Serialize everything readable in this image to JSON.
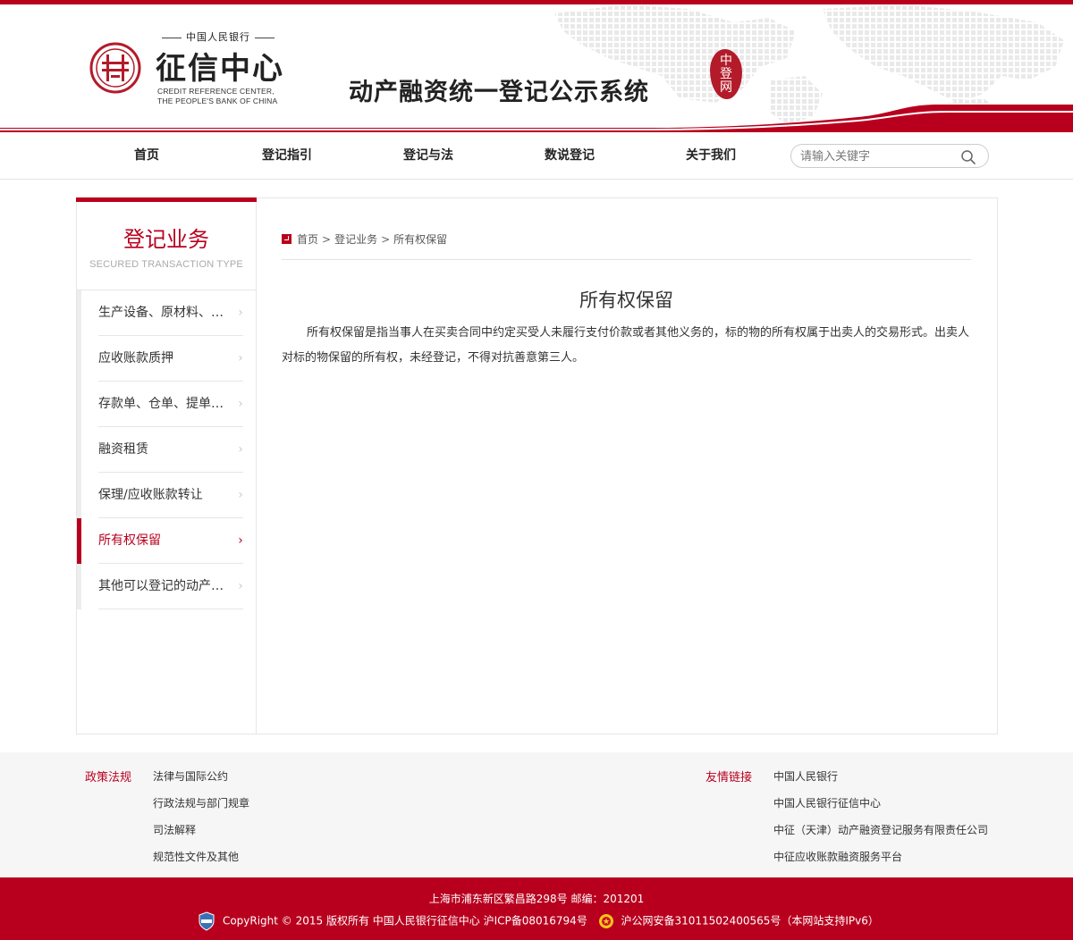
{
  "header": {
    "logo_top": "中国人民银行",
    "logo_cn": "征信中心",
    "logo_en_line1": "CREDIT REFERENCE CENTER,",
    "logo_en_line2": "THE PEOPLE'S BANK OF CHINA",
    "system_title": "动产融资统一登记公示系统",
    "seal_text": "中登网",
    "brand_color": "#b8001e"
  },
  "nav": {
    "items": [
      {
        "label": "首页"
      },
      {
        "label": "登记指引"
      },
      {
        "label": "登记与法"
      },
      {
        "label": "数说登记"
      },
      {
        "label": "关于我们"
      }
    ],
    "search_placeholder": "请输入关键字"
  },
  "sidebar": {
    "title": "登记业务",
    "subtitle": "SECURED TRANSACTION TYPE",
    "items": [
      {
        "label": "生产设备、原材料、半成品、产品抵押",
        "active": false
      },
      {
        "label": "应收账款质押",
        "active": false
      },
      {
        "label": "存款单、仓单、提单质押",
        "active": false
      },
      {
        "label": "融资租赁",
        "active": false
      },
      {
        "label": "保理/应收账款转让",
        "active": false
      },
      {
        "label": "所有权保留",
        "active": true
      },
      {
        "label": "其他可以登记的动产和权利担保",
        "active": false
      }
    ]
  },
  "breadcrumb": {
    "items": [
      "首页",
      "登记业务",
      "所有权保留"
    ],
    "separator": ">"
  },
  "article": {
    "title": "所有权保留",
    "body": "所有权保留是指当事人在买卖合同中约定买受人未履行支付价款或者其他义务的，标的物的所有权属于出卖人的交易形式。出卖人对标的物保留的所有权，未经登记，不得对抗善意第三人。"
  },
  "footer": {
    "policy_heading": "政策法规",
    "policy_links": [
      "法律与国际公约",
      "行政法规与部门规章",
      "司法解释",
      "规范性文件及其他"
    ],
    "friend_heading": "友情链接",
    "friend_links": [
      "中国人民银行",
      "中国人民银行征信中心",
      "中征（天津）动产融资登记服务有限责任公司",
      "中征应收账款融资服务平台"
    ],
    "address": "上海市浦东新区繁昌路298号 邮编：201201",
    "copyright": "CopyRight © 2015 版权所有 中国人民银行征信中心 沪ICP备08016794号",
    "police_record": "沪公网安备31011502400565号（本网站支持IPv6）"
  }
}
